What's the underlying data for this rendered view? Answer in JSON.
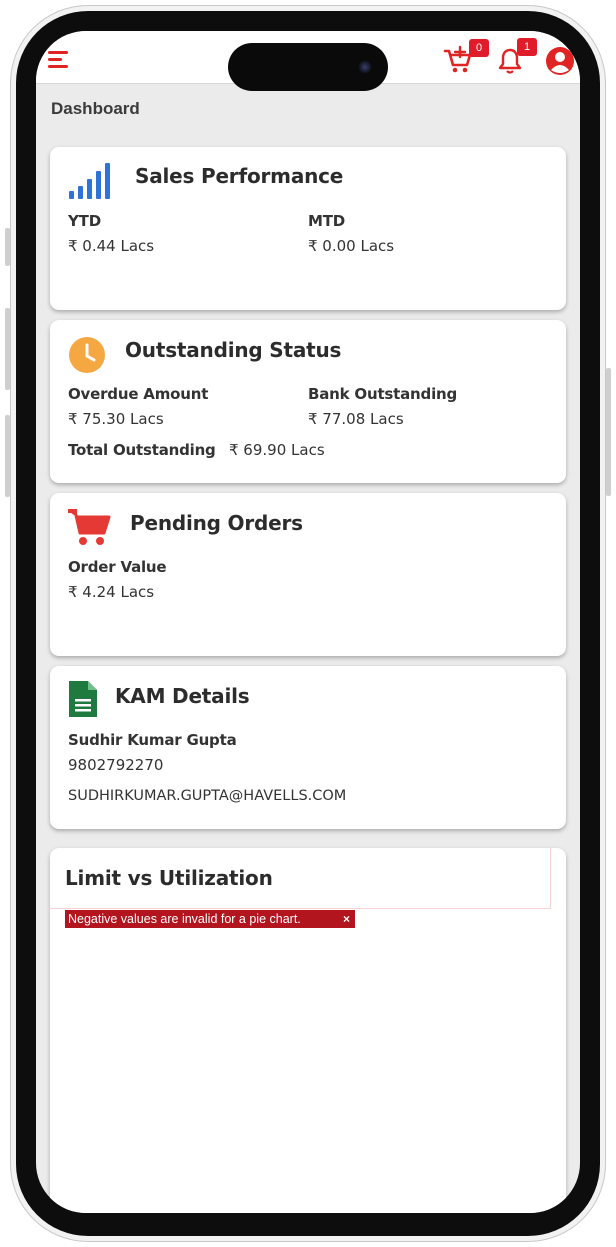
{
  "header": {
    "cart_badge": "0",
    "notification_badge": "1"
  },
  "page_title": "Dashboard",
  "sales": {
    "title": "Sales Performance",
    "ytd_label": "YTD",
    "ytd_value": "₹ 0.44 Lacs",
    "mtd_label": "MTD",
    "mtd_value": "₹ 0.00 Lacs"
  },
  "outstanding": {
    "title": "Outstanding Status",
    "overdue_label": "Overdue Amount",
    "overdue_value": "₹ 75.30 Lacs",
    "bank_label": "Bank Outstanding",
    "bank_value": "₹ 77.08 Lacs",
    "total_label": "Total Outstanding",
    "total_value": "₹ 69.90 Lacs"
  },
  "pending": {
    "title": "Pending Orders",
    "order_label": "Order Value",
    "order_value": "₹ 4.24 Lacs"
  },
  "kam": {
    "title": "KAM Details",
    "name": "Sudhir Kumar Gupta",
    "phone": "9802792270",
    "email": "SUDHIRKUMAR.GUPTA@HAVELLS.COM"
  },
  "limit": {
    "title": "Limit vs Utilization",
    "error_message": "Negative values are invalid for a pie chart.",
    "close_glyph": "×"
  },
  "colors": {
    "brand_red": "#e02424",
    "chart_blue": "#2f73d9",
    "clock_orange": "#f5a742",
    "cart_red": "#e53935",
    "doc_green": "#1f7a3f",
    "error_red": "#b3151e"
  },
  "icons": [
    "menu-icon",
    "add-to-cart-icon",
    "bell-icon",
    "user-icon",
    "signal-bars-icon",
    "clock-icon",
    "cart-icon",
    "document-icon"
  ]
}
